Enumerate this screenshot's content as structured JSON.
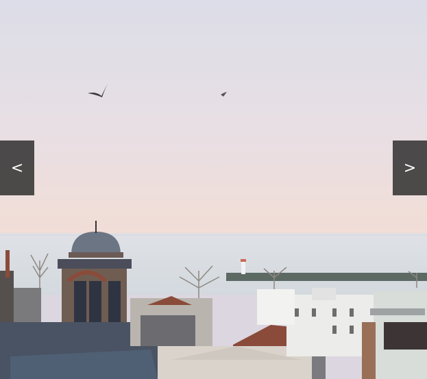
{
  "carousel": {
    "prev_label": "<",
    "next_label": ">",
    "prev_icon": "chevron-left-icon",
    "next_icon": "chevron-right-icon"
  },
  "photo": {
    "subject": "city-rooftops-by-the-sea",
    "colors": {
      "sky_top": "#dcdde8",
      "sky_mid": "#e7dee3",
      "sky_bottom": "#f1ddd7",
      "sea": "#d7dde2",
      "roof_dark": "#3f4a59",
      "building_light": "#e8e7e6",
      "roof_red": "#8a4b3a"
    }
  }
}
